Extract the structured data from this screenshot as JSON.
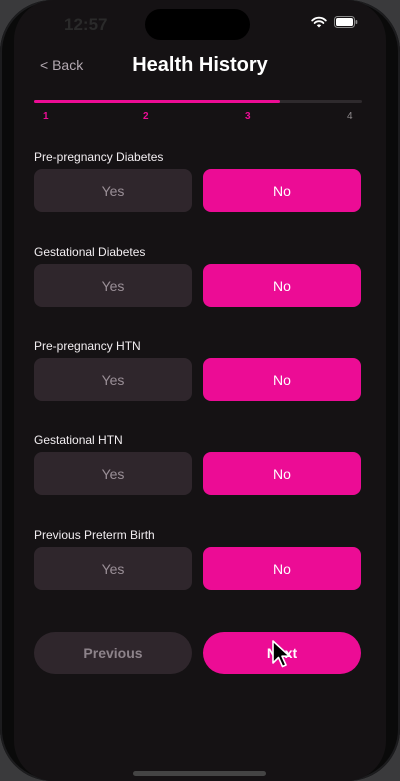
{
  "status_bar": {
    "time": "12:57",
    "icons": [
      "wifi-icon",
      "battery-icon"
    ]
  },
  "nav": {
    "back_label": "< Back",
    "title": "Health History"
  },
  "progress": {
    "current_step": 3,
    "total_steps": 4,
    "fill_fraction": 0.75,
    "steps": [
      "1",
      "2",
      "3",
      "4"
    ]
  },
  "questions": [
    {
      "label": "Pre-pregnancy Diabetes",
      "yes": "Yes",
      "no": "No",
      "selected": "No"
    },
    {
      "label": "Gestational Diabetes",
      "yes": "Yes",
      "no": "No",
      "selected": "No"
    },
    {
      "label": "Pre-pregnancy HTN",
      "yes": "Yes",
      "no": "No",
      "selected": "No"
    },
    {
      "label": "Gestational HTN",
      "yes": "Yes",
      "no": "No",
      "selected": "No"
    },
    {
      "label": "Previous Preterm Birth",
      "yes": "Yes",
      "no": "No",
      "selected": "No"
    }
  ],
  "footer": {
    "previous_label": "Previous",
    "next_label": "Next"
  },
  "colors": {
    "accent": "#ec0c95",
    "background": "#151214",
    "unselected": "#2f262c"
  }
}
